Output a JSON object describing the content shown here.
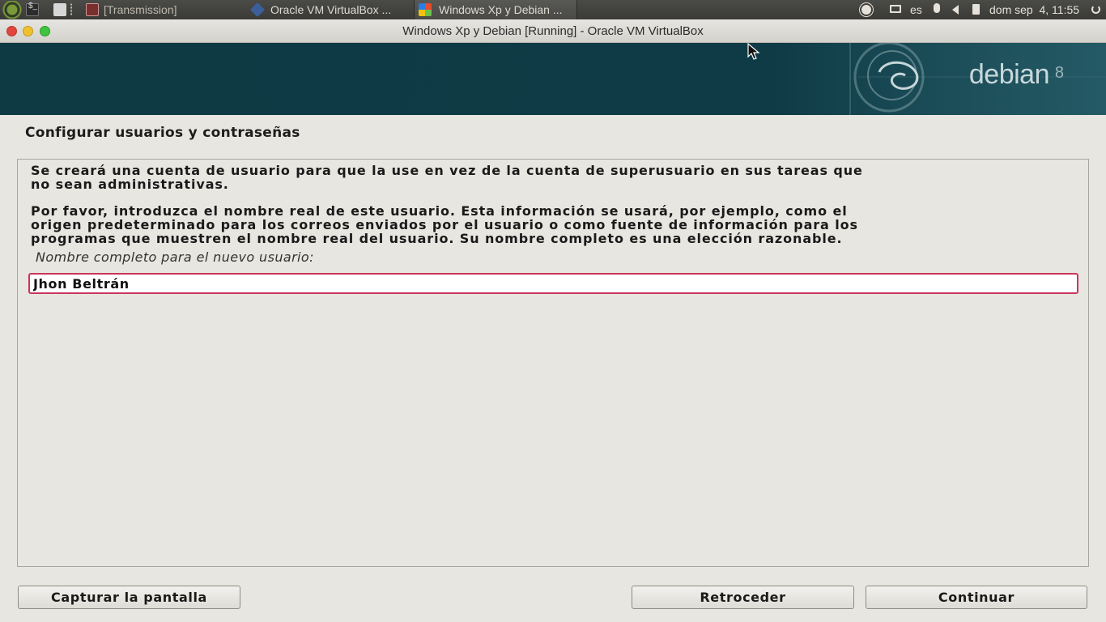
{
  "taskbar": {
    "tasks": [
      {
        "label": "[Transmission]"
      },
      {
        "label": "Oracle VM VirtualBox ..."
      },
      {
        "label": "Windows Xp y Debian ..."
      }
    ],
    "tray": {
      "keyboard_layout": "es",
      "clock": "dom sep  4, 11:55"
    }
  },
  "window": {
    "title": "Windows Xp y Debian [Running] - Oracle VM VirtualBox"
  },
  "banner": {
    "brand": "debian",
    "version": "8"
  },
  "installer": {
    "heading": "Configurar usuarios y contraseñas",
    "paragraph1_line1": "Se creará una cuenta de usuario para que la use en vez de la cuenta de superusuario en sus tareas que",
    "paragraph1_line2": "no sean administrativas.",
    "paragraph2_line1": "Por favor, introduzca el nombre real de este usuario. Esta información se usará, por ejemplo, como el",
    "paragraph2_line2": "origen predeterminado para los correos enviados por el usuario o como fuente de información para los",
    "paragraph2_line3": "programas que muestren el nombre real del usuario. Su nombre completo es una elección razonable.",
    "field_label": "Nombre completo para el nuevo usuario:",
    "field_value": "Jhon Beltrán"
  },
  "buttons": {
    "screenshot": "Capturar la pantalla",
    "back": "Retroceder",
    "continue": "Continuar"
  },
  "colors": {
    "banner_bg": "#0e3a44",
    "input_border": "#c9365f"
  }
}
